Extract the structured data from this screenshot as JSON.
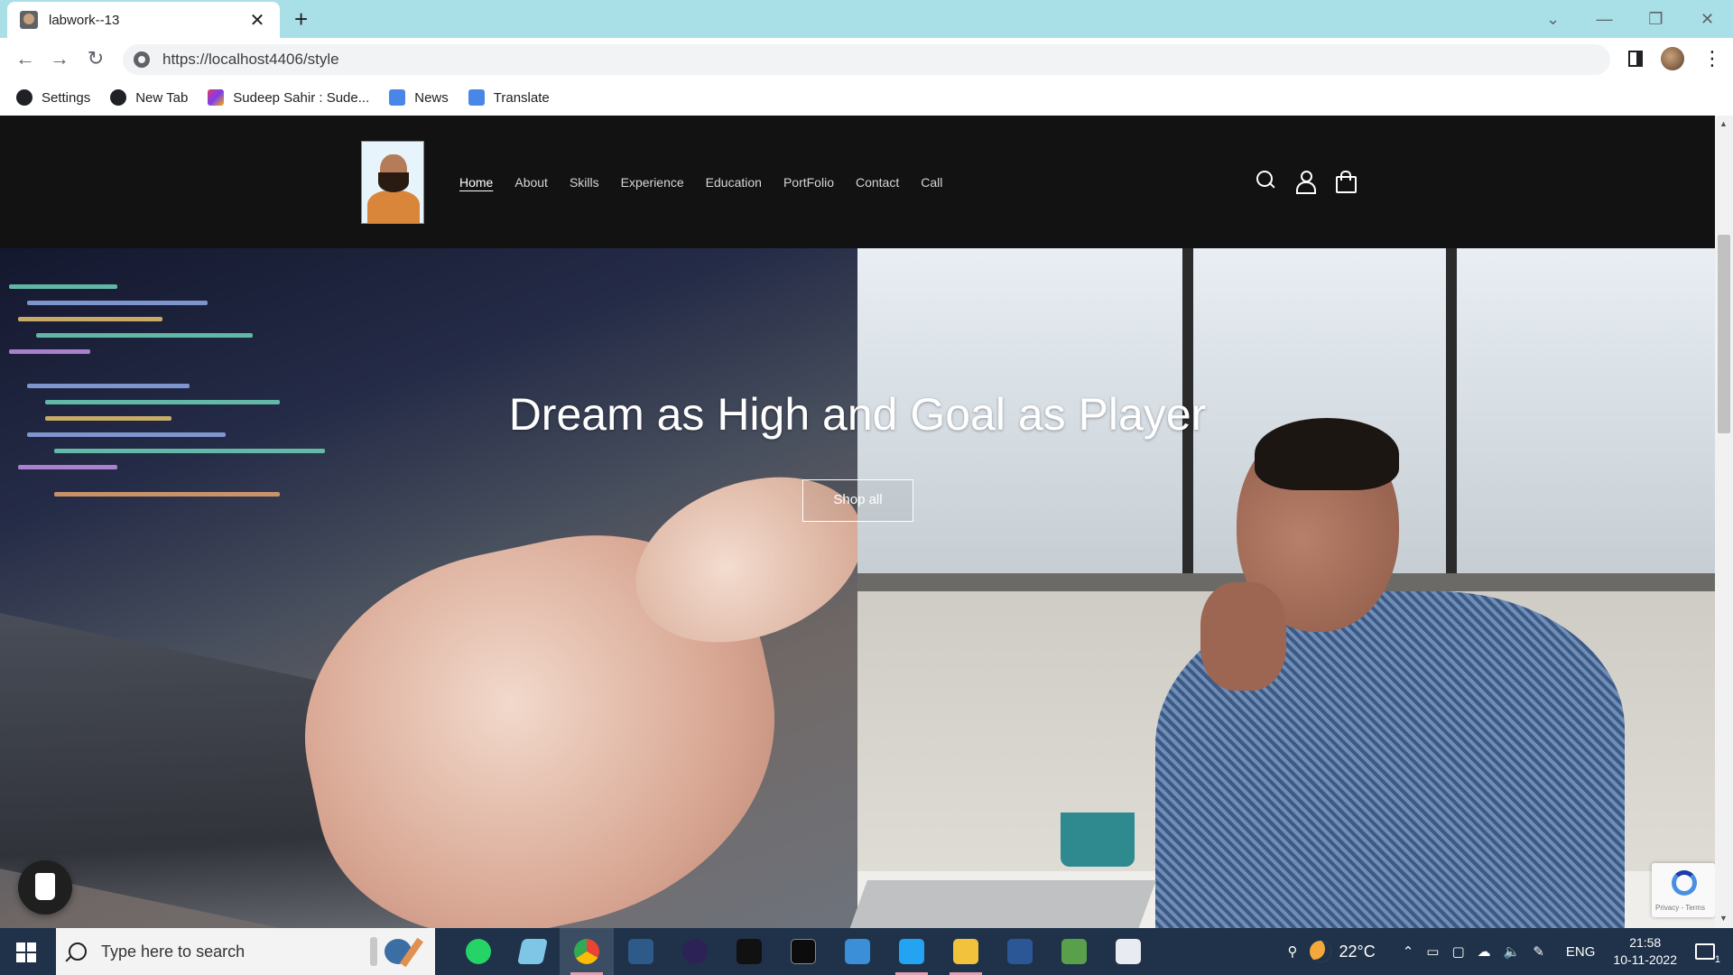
{
  "browser": {
    "tab_title": "labwork--13",
    "tab_close": "✕",
    "new_tab": "+",
    "url": "https://localhost4406/style",
    "window_controls": [
      "⌄",
      "—",
      "❐",
      "✕"
    ],
    "back": "←",
    "forward": "→",
    "reload": "↻",
    "kebab": "⋮"
  },
  "bookmarks": [
    {
      "label": "Settings",
      "icon": "globe-icon",
      "color": "#202124"
    },
    {
      "label": "New Tab",
      "icon": "globe-icon",
      "color": "#202124"
    },
    {
      "label": "Sudeep Sahir : Sude...",
      "icon": "pen-icon",
      "color": "#e5396b"
    },
    {
      "label": "News",
      "icon": "news-icon",
      "color": "#4a86e8"
    },
    {
      "label": "Translate",
      "icon": "translate-icon",
      "color": "#4a86e8"
    }
  ],
  "site": {
    "nav": [
      "Home",
      "About",
      "Skills",
      "Experience",
      "Education",
      "PortFolio",
      "Contact",
      "Call"
    ],
    "active_nav": "Home",
    "hero_title": "Dream as High and Goal as Player",
    "cta": "Shop all",
    "recaptcha_text": "Privacy - Terms"
  },
  "taskbar": {
    "search_placeholder": "Type here to search",
    "temperature": "22°C",
    "language": "ENG",
    "time": "21:58",
    "date": "10-11-2022",
    "notification_count": "1"
  },
  "colors": {
    "header_bg": "#121212",
    "tabstrip_bg": "#a9dfe6",
    "taskbar_bg": "#1f3249"
  }
}
